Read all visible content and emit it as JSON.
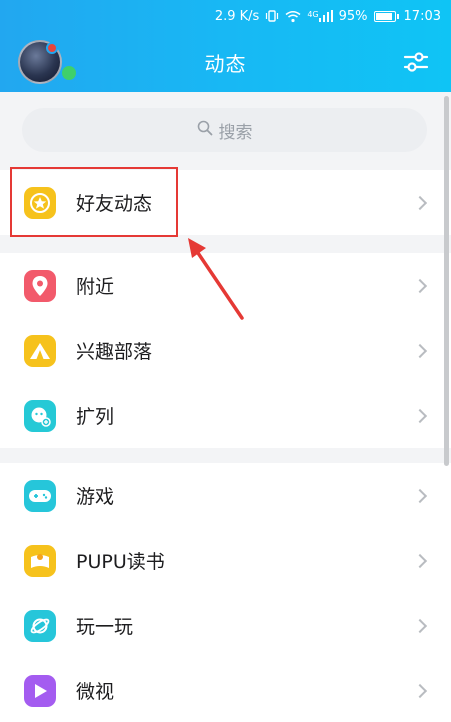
{
  "status_bar": {
    "speed": "2.9 K/s",
    "battery_percent": "95%",
    "time": "17:03",
    "signal_label": "4G"
  },
  "header": {
    "title": "动态"
  },
  "search": {
    "placeholder": "搜索"
  },
  "sections": [
    {
      "items": [
        {
          "label": "好友动态",
          "icon": "star-icon",
          "color": "#f6c21c"
        }
      ]
    },
    {
      "items": [
        {
          "label": "附近",
          "icon": "location-pin-icon",
          "color": "#f25a6b"
        },
        {
          "label": "兴趣部落",
          "icon": "tent-icon",
          "color": "#f6c21c"
        },
        {
          "label": "扩列",
          "icon": "chat-add-icon",
          "color": "#25c9d6"
        }
      ]
    },
    {
      "items": [
        {
          "label": "游戏",
          "icon": "gamepad-icon",
          "color": "#26c6da"
        },
        {
          "label": "PUPU读书",
          "icon": "book-icon",
          "color": "#f6c21c"
        },
        {
          "label": "玩一玩",
          "icon": "planet-icon",
          "color": "#26c6da"
        },
        {
          "label": "微视",
          "icon": "play-icon",
          "color": "#a45cf0"
        }
      ]
    }
  ],
  "colors": {
    "header_gradient_start": "#22a7f0",
    "header_gradient_end": "#0fc4f5",
    "annotation_red": "#e53935"
  }
}
